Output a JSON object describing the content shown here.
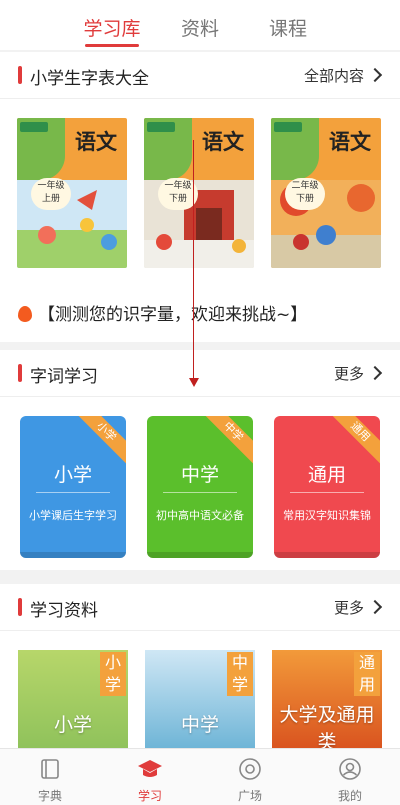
{
  "tabs": [
    {
      "label": "学习库"
    },
    {
      "label": "资料"
    },
    {
      "label": "课程"
    }
  ],
  "section_books": {
    "title": "小学生字表大全",
    "more": "全部内容",
    "books": [
      {
        "title": "语文",
        "grade": "一年级\n上册"
      },
      {
        "title": "语文",
        "grade": "一年级\n下册"
      },
      {
        "title": "语文",
        "grade": "二年级\n下册"
      }
    ]
  },
  "challenge": {
    "text": "【测测您的识字量，欢迎来挑战~】"
  },
  "section_words": {
    "title": "字词学习",
    "more": "更多",
    "cards": [
      {
        "name": "小学",
        "corner": "小学",
        "desc": "小学课后生字学习",
        "color": "#3f97e3"
      },
      {
        "name": "中学",
        "corner": "中学",
        "desc": "初中高中语文必备",
        "color": "#5bbf2c"
      },
      {
        "name": "通用",
        "corner": "通用",
        "desc": "常用汉字知识集锦",
        "color": "#f0494f"
      }
    ]
  },
  "section_materials": {
    "title": "学习资料",
    "more": "更多",
    "items": [
      {
        "tag": "小学",
        "big": "小学"
      },
      {
        "tag": "中学",
        "big": "中学"
      },
      {
        "tag": "通用",
        "big": "大学及通用类"
      }
    ]
  },
  "bottom_nav": [
    {
      "label": "字典",
      "icon": "book-icon"
    },
    {
      "label": "学习",
      "icon": "graduation-cap-icon"
    },
    {
      "label": "广场",
      "icon": "target-icon"
    },
    {
      "label": "我的",
      "icon": "user-icon"
    }
  ],
  "colors": {
    "accent": "#e03b3b",
    "orange": "#f3a13c"
  }
}
